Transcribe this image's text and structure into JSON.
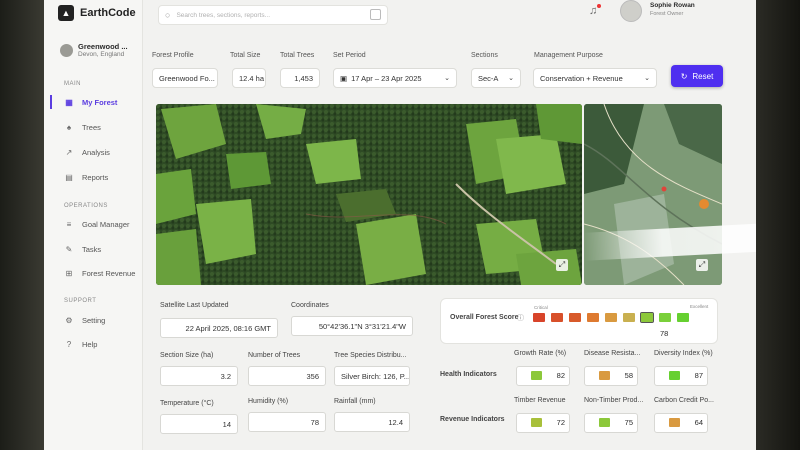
{
  "app": {
    "name": "EarthCode"
  },
  "search": {
    "placeholder": "Search trees, sections, reports..."
  },
  "user": {
    "name": "Sophie Rowan",
    "role": "Forest Owner"
  },
  "sidebar": {
    "profile": {
      "name": "Greenwood ...",
      "location": "Devon, England"
    },
    "main_title": "MAIN",
    "main_items": [
      {
        "label": "My Forest",
        "icon": "leaf-icon"
      },
      {
        "label": "Trees",
        "icon": "tree-icon"
      },
      {
        "label": "Analysis",
        "icon": "chart-icon"
      },
      {
        "label": "Reports",
        "icon": "report-icon"
      }
    ],
    "ops_title": "OPERATIONS",
    "ops_items": [
      {
        "label": "Goal Manager",
        "icon": "list-icon"
      },
      {
        "label": "Tasks",
        "icon": "edit-icon"
      },
      {
        "label": "Forest Revenue",
        "icon": "revenue-icon"
      }
    ],
    "support_title": "SUPPORT",
    "support_items": [
      {
        "label": "Setting",
        "icon": "gear-icon"
      },
      {
        "label": "Help",
        "icon": "help-icon"
      }
    ]
  },
  "filters": {
    "forest_profile": {
      "label": "Forest Profile",
      "value": "Greenwood Fo..."
    },
    "total_size": {
      "label": "Total Size",
      "value": "12.4 ha"
    },
    "total_trees": {
      "label": "Total Trees",
      "value": "1,453"
    },
    "set_period": {
      "label": "Set Period",
      "value": "17 Apr – 23 Apr 2025"
    },
    "sections": {
      "label": "Sections",
      "value": "Sec-A"
    },
    "management": {
      "label": "Management Purpose",
      "value": "Conservation + Revenue"
    },
    "reset_label": "Reset"
  },
  "satellite": {
    "updated_label": "Satellite Last Updated",
    "updated_value": "22 April 2025, 08:16 GMT",
    "coords_label": "Coordinates",
    "coords_value": "50°42'36.1\"N 3°31'21.4\"W"
  },
  "score": {
    "title": "Overall Forest Score",
    "critical_label": "Critical",
    "excellent_label": "Excellent",
    "value": "78",
    "colors": [
      "#d8442a",
      "#d8502a",
      "#d85a2a",
      "#de7a30",
      "#d99a40",
      "#c9b050",
      "#8cc83a",
      "#7ad03a",
      "#66d030"
    ],
    "selected_index": 6
  },
  "section_stats": {
    "size": {
      "label": "Section Size (ha)",
      "value": "3.2"
    },
    "trees": {
      "label": "Number of Trees",
      "value": "356"
    },
    "species": {
      "label": "Tree Species Distribu...",
      "value": "Silver Birch: 126, P..."
    },
    "temperature": {
      "label": "Temperature (°C)",
      "value": "14"
    },
    "humidity": {
      "label": "Humidity (%)",
      "value": "78"
    },
    "rainfall": {
      "label": "Rainfall (mm)",
      "value": "12.4"
    }
  },
  "indicators": {
    "health_label": "Health Indicators",
    "revenue_label": "Revenue Indicators",
    "health": [
      {
        "label": "Growth Rate (%)",
        "value": "82",
        "color": "#8cc83a"
      },
      {
        "label": "Disease Resista...",
        "value": "58",
        "color": "#d99a40"
      },
      {
        "label": "Diversity Index (%)",
        "value": "87",
        "color": "#66d030"
      }
    ],
    "revenue": [
      {
        "label": "Timber Revenue",
        "value": "72",
        "color": "#a8c03a"
      },
      {
        "label": "Non-Timber Prod...",
        "value": "75",
        "color": "#8cc83a"
      },
      {
        "label": "Carbon Credit Po...",
        "value": "64",
        "color": "#d99a40"
      }
    ]
  }
}
